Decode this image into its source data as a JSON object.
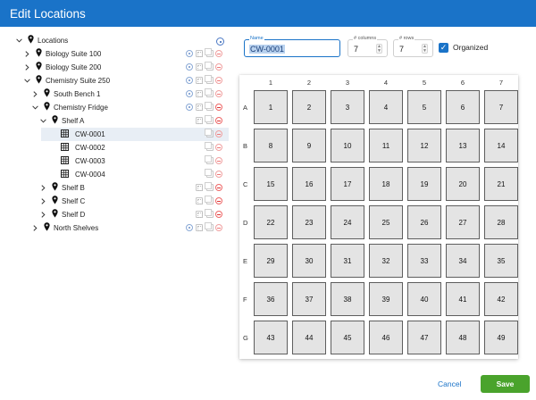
{
  "dialog": {
    "title": "Edit Locations"
  },
  "tree": [
    {
      "label": "Locations",
      "icon": "map-pin-icon",
      "expand": "expanded",
      "actions": "root"
    },
    {
      "label": "Biology Suite 100",
      "icon": "map-pin-icon",
      "expand": "collapsed",
      "actions": "full"
    },
    {
      "label": "Biology Suite 200",
      "icon": "map-pin-icon",
      "expand": "collapsed",
      "actions": "full"
    },
    {
      "label": "Chemistry Suite 250",
      "icon": "map-pin-icon",
      "expand": "expanded",
      "actions": "full"
    },
    {
      "label": "South Bench 1",
      "icon": "map-pin-icon",
      "expand": "collapsed",
      "actions": "full"
    },
    {
      "label": "Chemistry Fridge",
      "icon": "map-pin-icon",
      "expand": "expanded",
      "actions": "full-strong"
    },
    {
      "label": "Shelf A",
      "icon": "map-pin-icon",
      "expand": "expanded",
      "actions": "nocopy"
    },
    {
      "label": "CW-0001",
      "icon": "grid-icon",
      "expand": "none",
      "actions": "leaf",
      "selected": true
    },
    {
      "label": "CW-0002",
      "icon": "grid-icon",
      "expand": "none",
      "actions": "leaf"
    },
    {
      "label": "CW-0003",
      "icon": "grid-icon",
      "expand": "none",
      "actions": "leaf"
    },
    {
      "label": "CW-0004",
      "icon": "grid-icon",
      "expand": "none",
      "actions": "leaf"
    },
    {
      "label": "Shelf B",
      "icon": "map-pin-icon",
      "expand": "collapsed",
      "actions": "nocopy"
    },
    {
      "label": "Shelf C",
      "icon": "map-pin-icon",
      "expand": "collapsed",
      "actions": "nocopy"
    },
    {
      "label": "Shelf D",
      "icon": "map-pin-icon",
      "expand": "collapsed",
      "actions": "nocopy"
    },
    {
      "label": "North Shelves",
      "icon": "map-pin-icon",
      "expand": "collapsed",
      "actions": "full"
    }
  ],
  "form": {
    "name_label": "Name",
    "name_value": "CW-0001",
    "columns_label": "# columns",
    "columns_value": "7",
    "rows_label": "# rows",
    "rows_value": "7",
    "organized_label": "Organized",
    "organized_checked": true
  },
  "plate": {
    "column_headers": [
      "1",
      "2",
      "3",
      "4",
      "5",
      "6",
      "7"
    ],
    "row_headers": [
      "A",
      "B",
      "C",
      "D",
      "E",
      "F",
      "G"
    ],
    "cells": [
      [
        "1",
        "2",
        "3",
        "4",
        "5",
        "6",
        "7"
      ],
      [
        "8",
        "9",
        "10",
        "11",
        "12",
        "13",
        "14"
      ],
      [
        "15",
        "16",
        "17",
        "18",
        "19",
        "20",
        "21"
      ],
      [
        "22",
        "23",
        "24",
        "25",
        "26",
        "27",
        "28"
      ],
      [
        "29",
        "30",
        "31",
        "32",
        "33",
        "34",
        "35"
      ],
      [
        "36",
        "37",
        "38",
        "39",
        "40",
        "41",
        "42"
      ],
      [
        "43",
        "44",
        "45",
        "46",
        "47",
        "48",
        "49"
      ]
    ]
  },
  "footer": {
    "cancel_label": "Cancel",
    "save_label": "Save"
  },
  "colors": {
    "header": "#1a73c8",
    "accent": "#1a73c8",
    "save": "#4aa32c",
    "cell": "#e4e4e4"
  }
}
